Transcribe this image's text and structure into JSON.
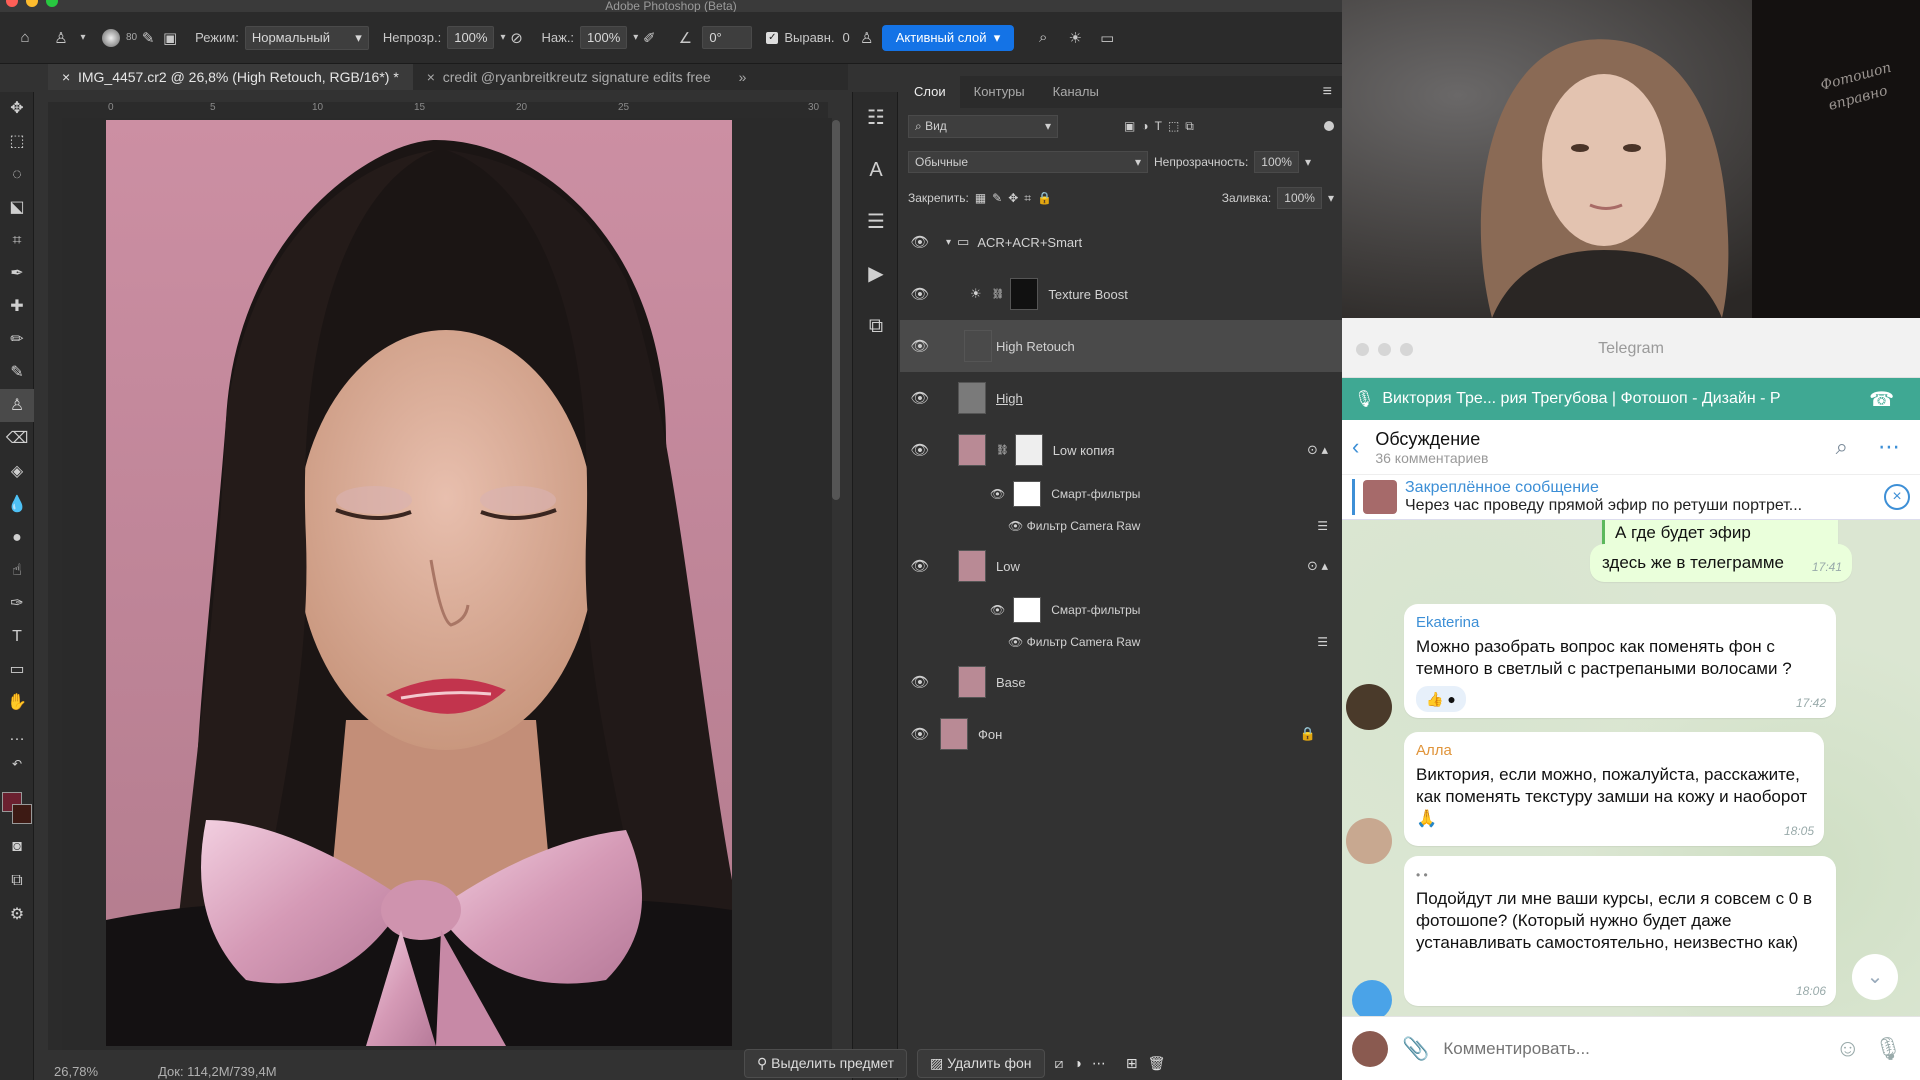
{
  "ps": {
    "window_title": "Adobe Photoshop (Beta)",
    "options": {
      "mode_label": "Режим:",
      "mode_value": "Нормальный",
      "opacity_label": "Непрозр.:",
      "opacity_value": "100%",
      "pressure_label": "Наж.:",
      "pressure_value": "100%",
      "angle_value": "0°",
      "align_label": "Выравн.",
      "sample_value": "0",
      "sample_mode": "Активный слой",
      "brush_size": "80"
    },
    "tabs": [
      {
        "label": "IMG_4457.cr2 @ 26,8% (High Retouch, RGB/16*) *"
      },
      {
        "label": "credit @ryanbreitkreutz signature edits free"
      }
    ],
    "ruler_ticks": [
      "0",
      "5",
      "10",
      "15",
      "20",
      "25",
      "30"
    ],
    "status": {
      "zoom": "26,78%",
      "doc": "Док: 114,2M/739,4M"
    },
    "layers_panel": {
      "tabs": [
        "Слои",
        "Контуры",
        "Каналы"
      ],
      "filter_placeholder": "Вид",
      "blend_mode": "Обычные",
      "opacity_label": "Непрозрачность:",
      "opacity_value": "100%",
      "lock_label": "Закрепить:",
      "fill_label": "Заливка:",
      "fill_value": "100%",
      "layers": [
        {
          "name": "ACR+ACR+Smart"
        },
        {
          "name": "Texture Boost"
        },
        {
          "name": "High Retouch"
        },
        {
          "name": "High"
        },
        {
          "name": "Low копия"
        },
        {
          "name": "Low"
        },
        {
          "name": "Base"
        },
        {
          "name": "Фон"
        }
      ],
      "smart_filters": "Смарт-фильтры",
      "camera_raw": "Фильтр Camera Raw"
    },
    "bottom_buttons": {
      "select_subject": "Выделить предмет",
      "remove_bg": "Удалить фон"
    }
  },
  "tg": {
    "title": "Telegram",
    "call_bar": "Виктория Тре... рия Трегубова | Фотошоп - Дизайн - Р",
    "header": {
      "title": "Обсуждение",
      "subtitle": "36 комментариев"
    },
    "pinned": {
      "label": "Закреплённое сообщение",
      "text": "Через час проведу прямой эфир по ретуши портрет..."
    },
    "messages": [
      {
        "text": "А где будет эфир проходить ?"
      },
      {
        "text": "здесь же в телеграмме",
        "time": "17:41"
      },
      {
        "name": "Ekaterina",
        "text": "Можно разобрать вопрос как поменять фон с темного в светлый с растрепаными волосами ?",
        "time": "17:42"
      },
      {
        "name": "Алла",
        "text": "Виктория, если можно, пожалуйста, расскажите, как поменять текстуру замши на кожу и наоборот🙏",
        "time": "18:05"
      },
      {
        "name": "• •",
        "text": "Подойдут ли мне ваши курсы, если я совсем с 0 в фотошопе? (Который нужно будет даже устанавливать самостоятельно, неизвестно как)",
        "time": "18:06"
      }
    ],
    "input_placeholder": "Комментировать...",
    "colors": {
      "accent": "#3fa893",
      "link": "#3d8fd6",
      "name_alla": "#e0943a"
    }
  },
  "cam": {
    "overlay_text": "Фотошоп\nвправно"
  }
}
